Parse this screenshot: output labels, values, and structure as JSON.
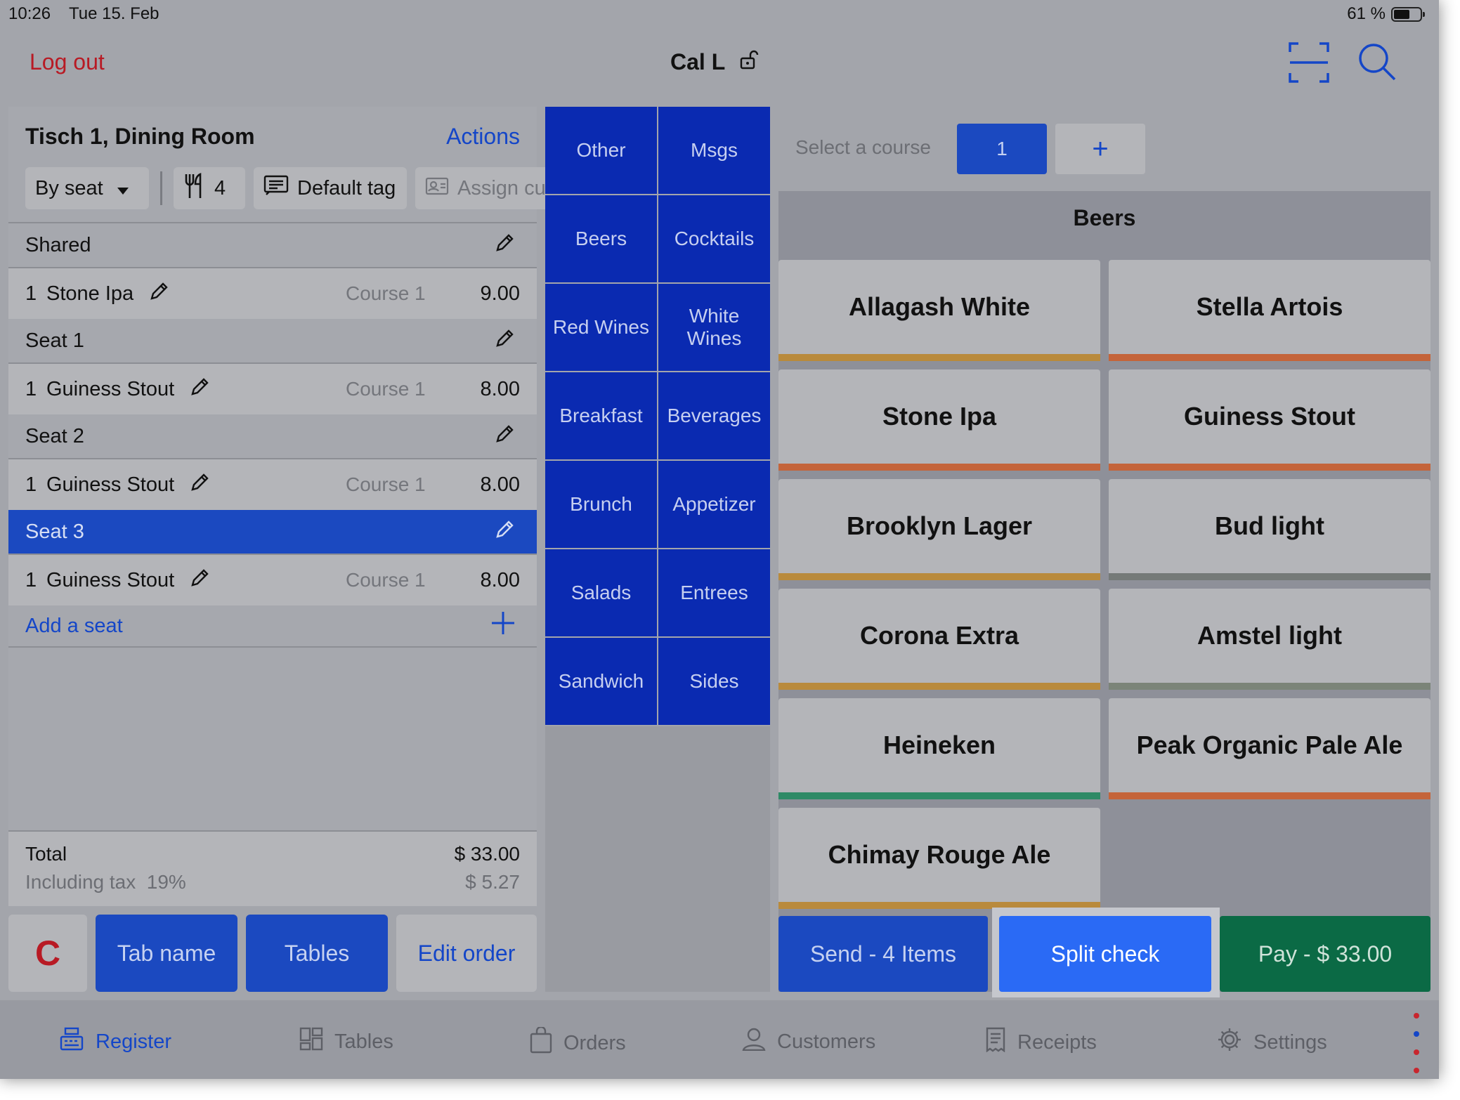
{
  "status": {
    "time": "10:26",
    "date": "Tue 15. Feb",
    "battery": "61 %",
    "battery_level": 0.61
  },
  "top": {
    "logout": "Log out",
    "user": "Cal L"
  },
  "order": {
    "title": "Tisch 1, Dining Room",
    "actions": "Actions",
    "chips": {
      "by_seat": "By seat",
      "guests": "4",
      "default_tag": "Default tag",
      "assign": "Assign cu"
    },
    "groups": [
      {
        "label": "Shared",
        "item": {
          "qty": "1",
          "name": "Stone Ipa",
          "course": "Course 1",
          "price": "9.00"
        }
      },
      {
        "label": "Seat 1",
        "item": {
          "qty": "1",
          "name": "Guiness Stout",
          "course": "Course 1",
          "price": "8.00"
        }
      },
      {
        "label": "Seat 2",
        "item": {
          "qty": "1",
          "name": "Guiness Stout",
          "course": "Course 1",
          "price": "8.00"
        }
      },
      {
        "label": "Seat 3",
        "item": {
          "qty": "1",
          "name": "Guiness Stout",
          "course": "Course 1",
          "price": "8.00"
        }
      }
    ],
    "add_seat": "Add a seat",
    "total_label": "Total",
    "total_value": "$ 33.00",
    "tax_label": "Including tax  19%",
    "tax_value": "$ 5.27"
  },
  "left_buttons": {
    "clear": "C",
    "tab_name": "Tab name",
    "tables": "Tables",
    "edit_order": "Edit order"
  },
  "categories": [
    "Other",
    "Msgs",
    "Beers",
    "Cocktails",
    "Red Wines",
    "White Wines",
    "Breakfast",
    "Beverages",
    "Brunch",
    "Appetizer",
    "Salads",
    "Entrees",
    "Sandwich",
    "Sides"
  ],
  "course_bar": {
    "label": "Select a course",
    "current": "1",
    "add": "+"
  },
  "section": "Beers",
  "products": [
    {
      "name": "Allagash White",
      "color": "#b98a3c"
    },
    {
      "name": "Stella Artois",
      "color": "#c4643a"
    },
    {
      "name": "Stone Ipa",
      "color": "#c4643a"
    },
    {
      "name": "Guiness Stout",
      "color": "#c4643a"
    },
    {
      "name": "Brooklyn Lager",
      "color": "#b98a3c"
    },
    {
      "name": "Bud light",
      "color": "#757a78"
    },
    {
      "name": "Corona Extra",
      "color": "#b98a3c"
    },
    {
      "name": "Amstel light",
      "color": "#7b8478"
    },
    {
      "name": "Heineken",
      "color": "#2e8a66"
    },
    {
      "name": "Peak Organic Pale Ale",
      "color": "#c4643a"
    },
    {
      "name": "Chimay Rouge Ale",
      "color": "#b98a3c"
    }
  ],
  "actions_bar": {
    "send": "Send - 4 Items",
    "split": "Split check",
    "pay": "Pay - $ 33.00"
  },
  "tabs": [
    {
      "label": "Register",
      "icon": "register-icon"
    },
    {
      "label": "Tables",
      "icon": "tables-icon"
    },
    {
      "label": "Orders",
      "icon": "bag-icon"
    },
    {
      "label": "Customers",
      "icon": "person-icon"
    },
    {
      "label": "Receipts",
      "icon": "receipt-icon"
    },
    {
      "label": "Settings",
      "icon": "gear-icon"
    }
  ],
  "colors": {
    "accent": "#1b49c0",
    "category": "#0a2ab1",
    "pay": "#0b6a45",
    "split": "#2a6af5",
    "logout": "#b81a24"
  }
}
